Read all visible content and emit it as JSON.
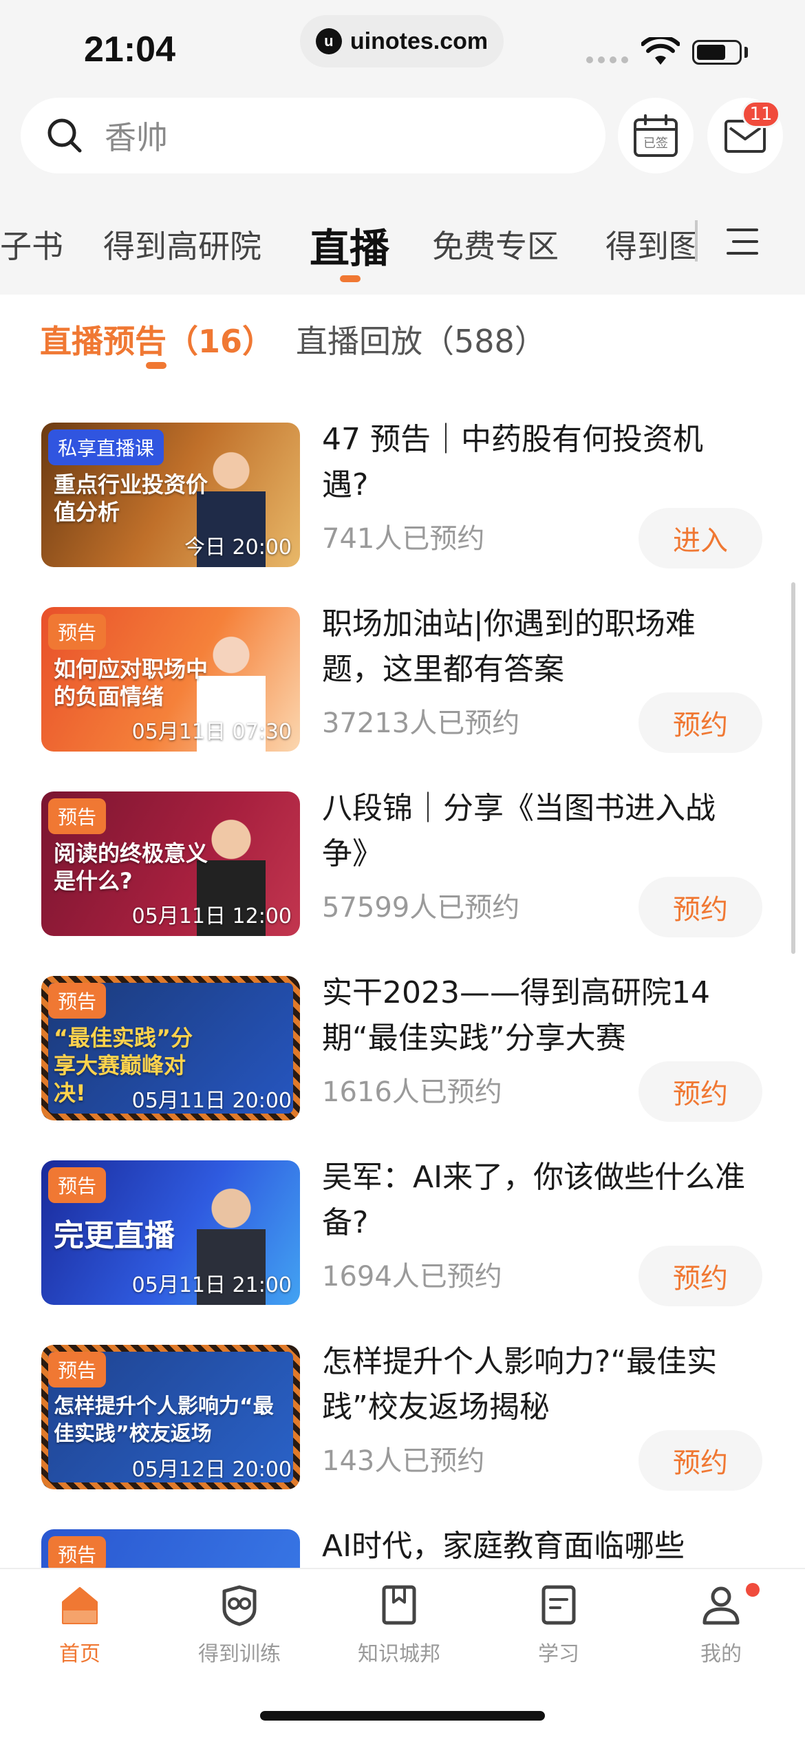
{
  "status_bar": {
    "time": "21:04",
    "url": "uinotes.com",
    "url_logo": "u"
  },
  "search": {
    "placeholder": "香帅"
  },
  "header_icons": {
    "checkin_label": "已签",
    "mail_badge": "11"
  },
  "tabs": [
    {
      "label": "子书"
    },
    {
      "label": "得到高研院"
    },
    {
      "label": "直播"
    },
    {
      "label": "免费专区"
    },
    {
      "label": "得到图"
    }
  ],
  "subtabs": {
    "active": "直播预告（16）",
    "inactive": "直播回放（588）"
  },
  "items": [
    {
      "tag": "私享直播课",
      "headline": "重点行业投资价值分析",
      "time": "今日 20:00",
      "title": "47 预告｜中药股有何投资机遇?",
      "count": "741人已预约",
      "action": "进入"
    },
    {
      "tag": "预告",
      "headline": "如何应对职场中的负面情绪",
      "time": "05月11日 07:30",
      "title": "职场加油站|你遇到的职场难题，这里都有答案",
      "count": "37213人已预约",
      "action": "预约"
    },
    {
      "tag": "预告",
      "headline": "阅读的终极意义是什么?",
      "time": "05月11日 12:00",
      "title": "八段锦｜分享《当图书进入战争》",
      "count": "57599人已预约",
      "action": "预约"
    },
    {
      "tag": "预告",
      "headline": "“最佳实践”分享大赛巅峰对决!",
      "time": "05月11日 20:00",
      "title": "实干2023——得到高研院14期“最佳实践”分享大赛",
      "count": "1616人已预约",
      "action": "预约"
    },
    {
      "tag": "预告",
      "headline": "完更直播",
      "time": "05月11日 21:00",
      "title": "吴军：AI来了，你该做些什么准备?",
      "count": "1694人已预约",
      "action": "预约"
    },
    {
      "tag": "预告",
      "headline": "怎样提升个人影响力“最佳实践”校友返场",
      "time": "05月12日 20:00",
      "title": "怎样提升个人影响力?“最佳实践”校友返场揭秘",
      "count": "143人已预约",
      "action": "预约"
    },
    {
      "tag": "预告",
      "headline": "",
      "time": "",
      "title": "AI时代，家庭教育面临哪些",
      "count": "",
      "action": ""
    }
  ],
  "bottom_nav": [
    {
      "label": "首页",
      "icon": "home-icon"
    },
    {
      "label": "得到训练",
      "icon": "owl-icon"
    },
    {
      "label": "知识城邦",
      "icon": "bookmark-icon"
    },
    {
      "label": "学习",
      "icon": "document-icon"
    },
    {
      "label": "我的",
      "icon": "user-icon"
    }
  ],
  "colors": {
    "accent": "#f07833",
    "badge": "#f04b3c"
  }
}
